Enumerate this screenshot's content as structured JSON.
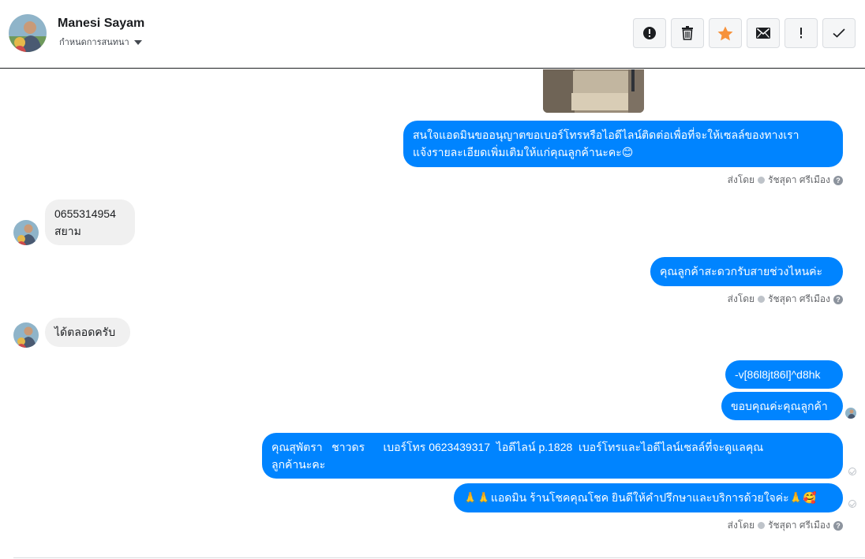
{
  "header": {
    "contact_name": "Manesi Sayam",
    "subtitle": "กำหนดการสนทนา",
    "actions": [
      {
        "icon": "alert-circle-icon",
        "color": "#1c1e21"
      },
      {
        "icon": "trash-icon",
        "color": "#1c1e21"
      },
      {
        "icon": "star-icon",
        "color": "#f7923b"
      },
      {
        "icon": "envelope-icon",
        "color": "#1c1e21"
      },
      {
        "icon": "exclamation-icon",
        "color": "#1c1e21"
      },
      {
        "icon": "checkmark-icon",
        "color": "#1c1e21"
      }
    ]
  },
  "colors": {
    "outgoing_bubble": "#0084ff",
    "incoming_bubble": "#f0f0f0",
    "star": "#f7923b"
  },
  "messages": {
    "m1_line1": "สนใจแอดมินขออนุญาตขอเบอร์โทรหรือไอดีไลน์ติดต่อเพื่อที่จะให้เซลล์ของทางเรา",
    "m1_line2": "แจ้งรายละเอียดเพิ่มเติมให้แก่คุณลูกค้านะคะ😊",
    "m2_line1": "0655314954",
    "m2_line2": "สยาม",
    "m3": "คุณลูกค้าสะดวกรับสายช่วงไหนค่ะ",
    "m4": "ได้ตลอดครับ",
    "m5": "-v[86l8jt86l]^d8hk",
    "m6": "ขอบคุณค่ะคุณลูกค้า",
    "m7_line1": "คุณสุพัตรา   ชาวดร      เบอร์โทร 0623439317  ไอดีไลน์ p.1828  เบอร์โทรและไอดีไลน์เซลล์ที่จะดูแลคุณ",
    "m7_line2": "ลูกค้านะคะ",
    "m8": "🙏🙏แอดมิน ร้านโชคคุณโชค ยินดีให้คำปรึกษาและบริการด้วยใจค่ะ🙏🥰"
  },
  "sent_by": {
    "prefix": "ส่งโดย",
    "agent": "รัชสุดา ศรีเมือง",
    "help": "?"
  }
}
